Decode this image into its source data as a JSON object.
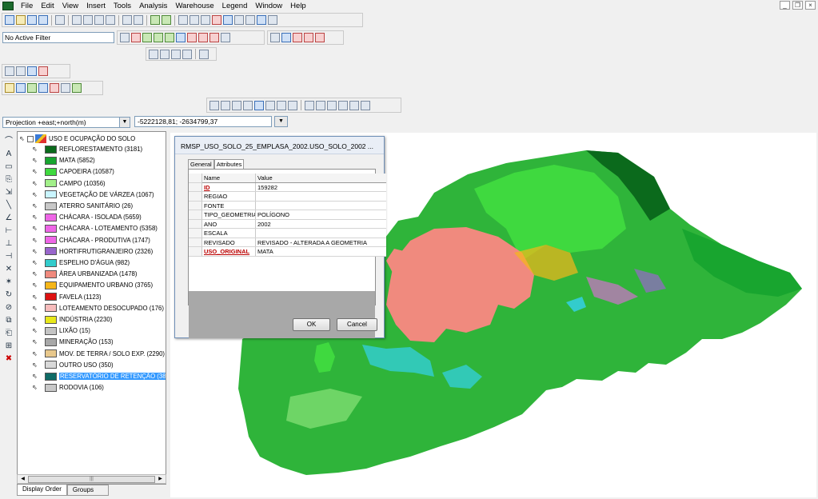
{
  "menu": [
    "File",
    "Edit",
    "View",
    "Insert",
    "Tools",
    "Analysis",
    "Warehouse",
    "Legend",
    "Window",
    "Help"
  ],
  "filter": {
    "value": "No Active Filter"
  },
  "projection": {
    "value": "Projection +east;+north(m)"
  },
  "coordinates": {
    "value": "-5222128,81; -2634799,37"
  },
  "legend": {
    "title": "USO E OCUPAÇÃO DO SOLO",
    "items": [
      {
        "label": "REFLORESTAMENTO (3181)",
        "color": "#0b6a1c"
      },
      {
        "label": "MATA (5852)",
        "color": "#18a52f"
      },
      {
        "label": "CAPOEIRA (10587)",
        "color": "#3fd93f"
      },
      {
        "label": "CAMPO (10356)",
        "color": "#a2f08a"
      },
      {
        "label": "VEGETAÇÃO DE VÁRZEA (1067)",
        "color": "#c9f5ff"
      },
      {
        "label": "ATERRO SANITÁRIO (26)",
        "color": "#c8c8c8"
      },
      {
        "label": "CHÁCARA - ISOLADA (5659)",
        "color": "#ee66e6"
      },
      {
        "label": "CHÁCARA - LOTEAMENTO (5358)",
        "color": "#ee66e6"
      },
      {
        "label": "CHÁCARA - PRODUTIVA (1747)",
        "color": "#ee66e6"
      },
      {
        "label": "HORTIFRUTIGRANJEIRO (2326)",
        "color": "#9966cc"
      },
      {
        "label": "ESPELHO D'ÁGUA (982)",
        "color": "#33cccc"
      },
      {
        "label": "ÁREA URBANIZADA (1478)",
        "color": "#f08a7e"
      },
      {
        "label": "EQUIPAMENTO URBANO (3765)",
        "color": "#f5b619"
      },
      {
        "label": "FAVELA (1123)",
        "color": "#dd1111"
      },
      {
        "label": "LOTEAMENTO DESOCUPADO (176)",
        "color": "#f7bcbc"
      },
      {
        "label": "INDÚSTRIA (2230)",
        "color": "#e8e81a"
      },
      {
        "label": "LIXÃO (15)",
        "color": "#c4c4c4"
      },
      {
        "label": "MINERAÇÃO (153)",
        "color": "#a8a8a8"
      },
      {
        "label": "MOV. DE TERRA / SOLO EXP. (2290)",
        "color": "#e8c88c"
      },
      {
        "label": "OUTRO USO (350)",
        "color": "#d8d8d8"
      },
      {
        "label": "RESERVATÓRIO DE RETENÇÃO (38)",
        "color": "#0f6b66",
        "selected": true
      },
      {
        "label": "RODOVIA (106)",
        "color": "#c8c8c8"
      }
    ]
  },
  "tabs": {
    "display_order": "Display Order",
    "groups": "Groups"
  },
  "dialog": {
    "title": "RMSP_USO_SOLO_25_EMPLASA_2002.USO_SOLO_2002 ...",
    "tab_general": "General",
    "tab_attributes": "Attributes",
    "col_name": "Name",
    "col_value": "Value",
    "rows": [
      {
        "name": "ID",
        "value": "159282",
        "key": true
      },
      {
        "name": "REGIAO",
        "value": ""
      },
      {
        "name": "FONTE",
        "value": ""
      },
      {
        "name": "TIPO_GEOMETRIA",
        "value": "POLÍGONO"
      },
      {
        "name": "ANO",
        "value": "2002"
      },
      {
        "name": "ESCALA",
        "value": ""
      },
      {
        "name": "REVISADO",
        "value": "REVISADO - ALTERADA A GEOMETRIA"
      },
      {
        "name": "USO_ORIGINAL",
        "value": "MATA",
        "key": true
      }
    ],
    "ok": "OK",
    "cancel": "Cancel"
  },
  "colors": {
    "forest": "#18a52f",
    "capoeira": "#3fd93f",
    "urban": "#f08a7e",
    "water": "#33cccc",
    "reflorest": "#0b6a1c"
  }
}
